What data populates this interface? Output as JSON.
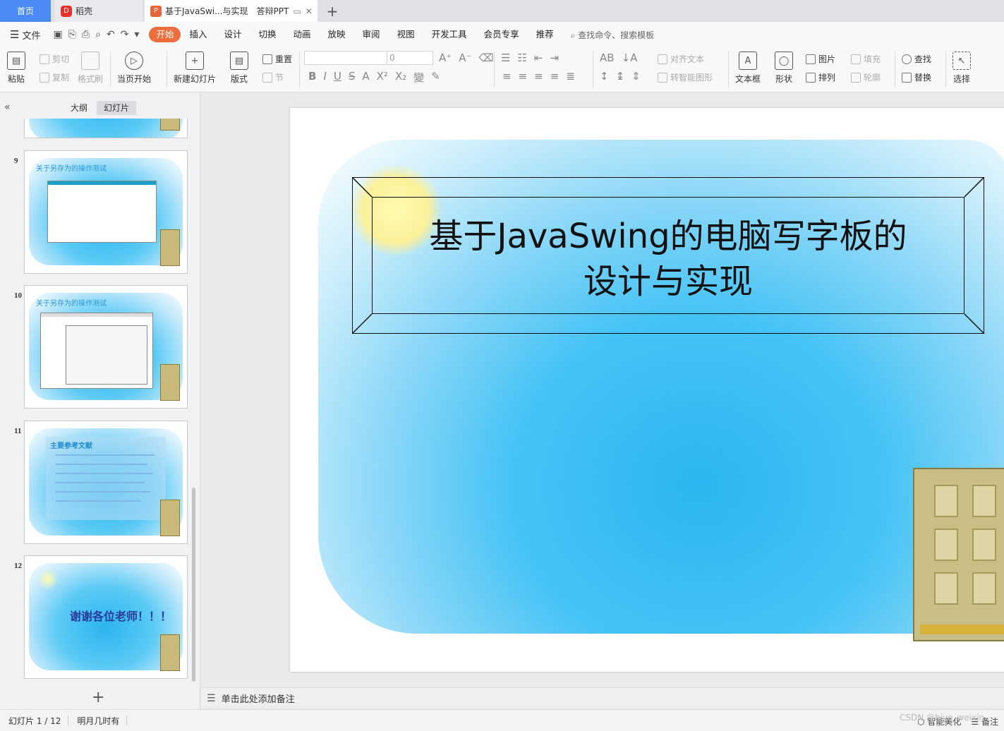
{
  "tabs": {
    "home": "首页",
    "docer": "稻壳",
    "file": "基于JavaSwi...与实现",
    "file_extra": "答辩PPT",
    "new_tab": "+"
  },
  "menu": {
    "file": "文件",
    "tabs": [
      "开始",
      "插入",
      "设计",
      "切换",
      "动画",
      "放映",
      "审阅",
      "视图",
      "开发工具",
      "会员专享",
      "推荐"
    ],
    "search": "查找命令、搜索模板"
  },
  "ribbon": {
    "paste": "粘贴",
    "cut": "剪切",
    "copy": "复制",
    "format_painter": "格式刷",
    "from_current": "当页开始",
    "new_slide": "新建幻灯片",
    "layout": "版式",
    "reset": "重置",
    "section": "节",
    "font_size": "0",
    "align_text": "对齐文本",
    "smart_shape": "转智能图形",
    "textbox": "文本框",
    "shape": "形状",
    "picture": "图片",
    "arrange": "排列",
    "fill": "填充",
    "outline": "轮廓",
    "find": "查找",
    "replace": "替换",
    "select": "选择"
  },
  "panel": {
    "outline_tab": "大纲",
    "slides_tab": "幻灯片",
    "thumbs": [
      {
        "num": "9",
        "title": "关于另存为的操作测试"
      },
      {
        "num": "10",
        "title": "关于另存为的操作测试"
      },
      {
        "num": "11",
        "title": "主要参考文献"
      },
      {
        "num": "12",
        "title": "谢谢各位老师！！！"
      }
    ],
    "add": "+"
  },
  "slide": {
    "title_line1": "基于JavaSwing的电脑写字板的",
    "title_line2": "设计与实现"
  },
  "notes": {
    "placeholder": "单击此处添加备注"
  },
  "status": {
    "slide_info": "幻灯片 1 / 12",
    "theme": "明月几时有",
    "smart_beautify": "智能美化",
    "notes": "备注",
    "watermark": "CSDN @biye_weixin"
  }
}
